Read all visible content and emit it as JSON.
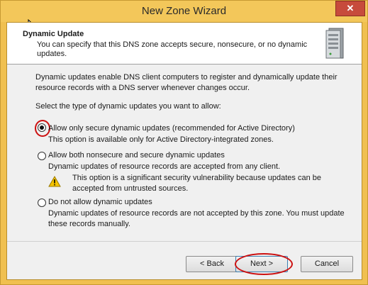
{
  "window": {
    "title": "New Zone Wizard",
    "close_glyph": "✕"
  },
  "header": {
    "title": "Dynamic Update",
    "description": "You can specify that this DNS zone accepts secure, nonsecure, or no dynamic updates.",
    "icon": "server-icon"
  },
  "intro": "Dynamic updates enable DNS client computers to register and dynamically update their resource records with a DNS server whenever changes occur.",
  "prompt": "Select the type of dynamic updates you want to allow:",
  "options": [
    {
      "label": "Allow only secure dynamic updates (recommended for Active Directory)",
      "sub": "This option is available only for Active Directory-integrated zones.",
      "selected": true
    },
    {
      "label": "Allow both nonsecure and secure dynamic updates",
      "sub": "Dynamic updates of resource records are accepted from any client.",
      "warning": "This option is a significant security vulnerability because updates can be accepted from untrusted sources.",
      "selected": false
    },
    {
      "label": "Do not allow dynamic updates",
      "sub": "Dynamic updates of resource records are not accepted by this zone. You must update these records manually.",
      "selected": false
    }
  ],
  "buttons": {
    "back": "< Back",
    "next": "Next >",
    "cancel": "Cancel"
  },
  "colors": {
    "title_bar": "#f3c75a",
    "close": "#c74b3c",
    "annotation": "#cc1010"
  }
}
